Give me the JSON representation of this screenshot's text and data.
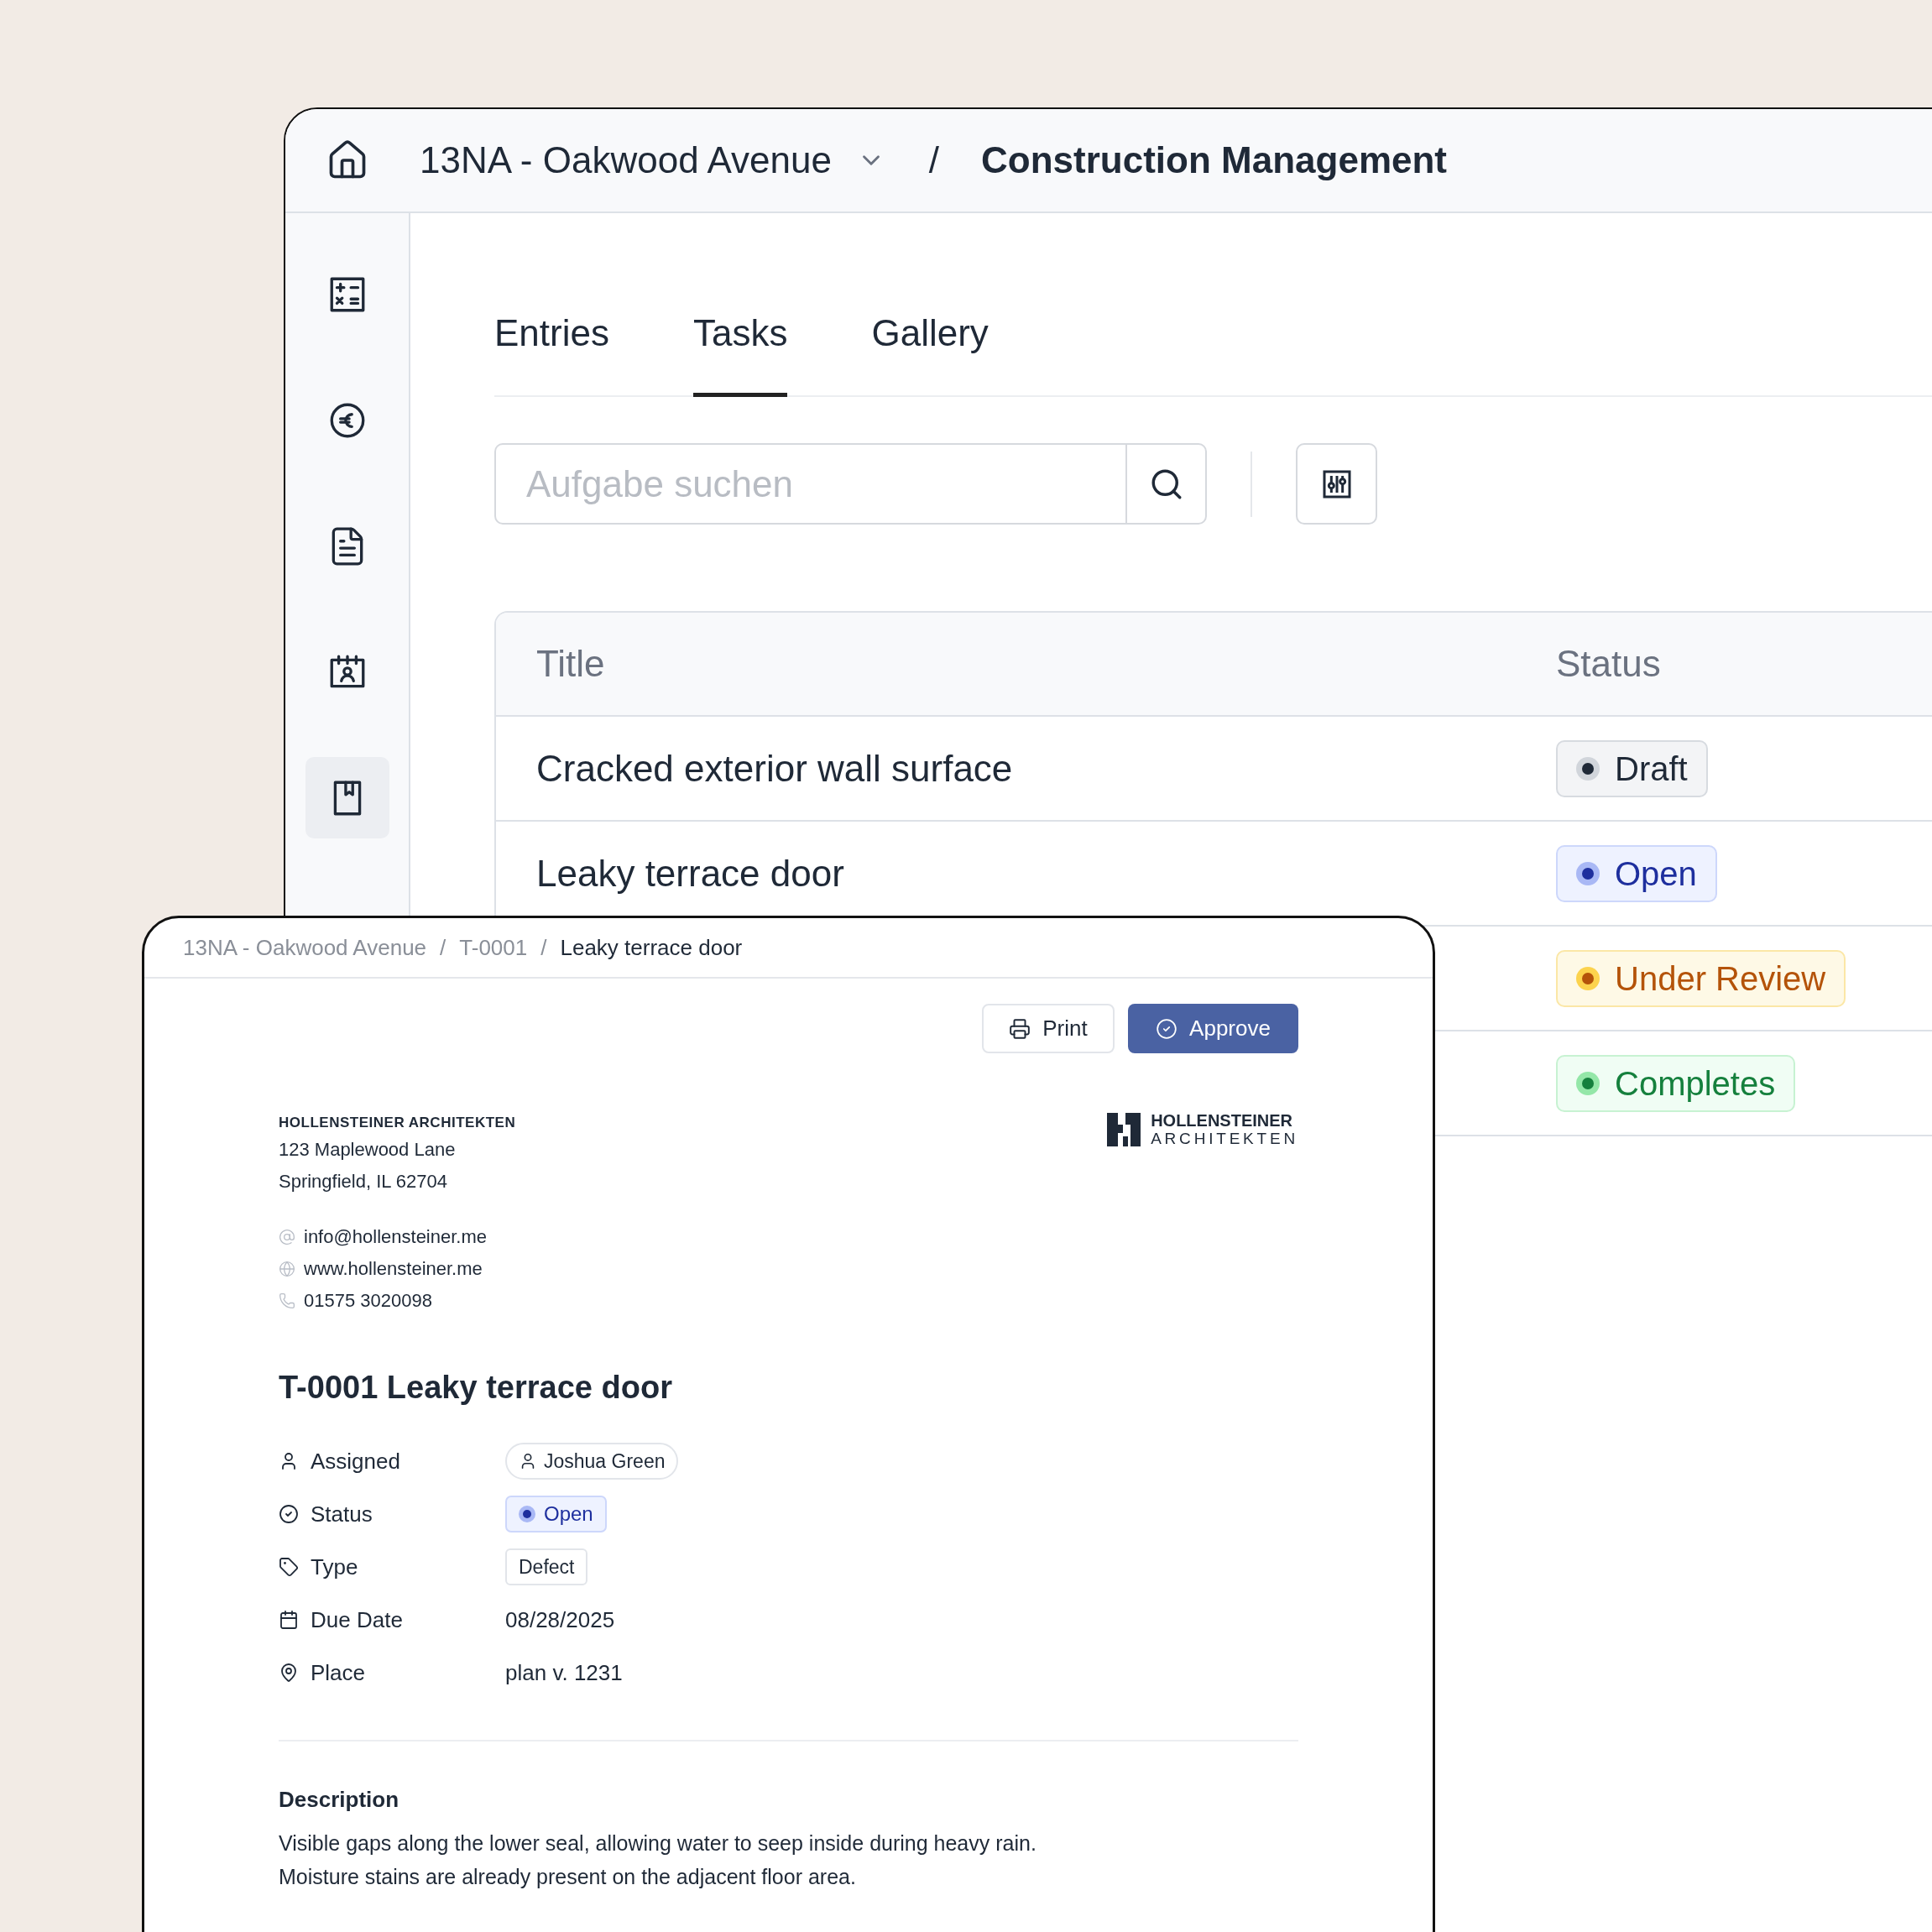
{
  "header": {
    "project": "13NA - Oakwood Avenue",
    "separator": "/",
    "title": "Construction Management"
  },
  "sidebar": {
    "items": [
      {
        "kind": "calculator",
        "selected": false
      },
      {
        "kind": "euro",
        "selected": false
      },
      {
        "kind": "document",
        "selected": false
      },
      {
        "kind": "calendar",
        "selected": false
      },
      {
        "kind": "book",
        "selected": true
      }
    ]
  },
  "tabs": [
    {
      "label": "Entries",
      "selected": false
    },
    {
      "label": "Tasks",
      "selected": true
    },
    {
      "label": "Gallery",
      "selected": false
    }
  ],
  "search": {
    "placeholder": "Aufgabe suchen"
  },
  "table": {
    "columns": [
      "Title",
      "Status"
    ],
    "rows": [
      {
        "title": "Cracked exterior wall surface",
        "status": {
          "label": "Draft",
          "kind": "draft",
          "color": "#1f2937"
        }
      },
      {
        "title": "Leaky terrace door",
        "status": {
          "label": "Open",
          "kind": "open",
          "color": "#1e2f9e"
        }
      },
      {
        "status": {
          "label": "Under Review",
          "kind": "review",
          "color": "#b45309"
        }
      },
      {
        "status": {
          "label": "Completes",
          "kind": "done",
          "color": "#15803d"
        }
      }
    ]
  },
  "detail": {
    "breadcrumb": [
      "13NA - Oakwood Avenue",
      "T-0001",
      "Leaky terrace door"
    ],
    "separator": "/",
    "actions": [
      {
        "kind": "print",
        "label": "Print"
      },
      {
        "kind": "approve",
        "label": "Approve"
      }
    ],
    "company": {
      "name": "HOLLENSTEINER ARCHITEKTEN",
      "address": [
        "123 Maplewood Lane",
        "Springfield, IL 62704"
      ],
      "contacts": [
        {
          "kind": "email",
          "text": "info@hollensteiner.me"
        },
        {
          "kind": "web",
          "text": "www.hollensteiner.me"
        },
        {
          "kind": "phone",
          "text": "01575 3020098"
        }
      ]
    },
    "logo": {
      "line1": "HOLLENSTEINER",
      "line2": "ARCHITEKTEN"
    },
    "heading": "T-0001 Leaky terrace door",
    "fields": [
      {
        "kind": "assigned",
        "label": "Assigned",
        "value": "Joshua Green"
      },
      {
        "kind": "status",
        "label": "Status",
        "badge": {
          "label": "Open",
          "kind": "open",
          "color": "#1e2f9e"
        }
      },
      {
        "kind": "type",
        "label": "Type",
        "value": "Defect"
      },
      {
        "kind": "date",
        "label": "Due Date",
        "value": "08/28/2025"
      },
      {
        "kind": "place",
        "label": "Place",
        "value": "plan v. 1231"
      }
    ],
    "description": {
      "heading": "Description",
      "lines": [
        "Visible gaps along the lower seal, allowing water to seep inside during heavy rain.",
        "Moisture stains are already present on the adjacent floor area."
      ]
    }
  }
}
